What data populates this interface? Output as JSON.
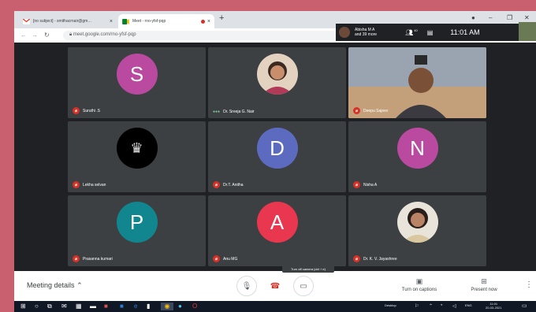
{
  "browser": {
    "tabs": [
      {
        "title": "[no subject] - smithacrnair@gm…",
        "active": false
      },
      {
        "title": "Meet - rno-yfsf-pqp",
        "active": true
      }
    ],
    "url": "meet.google.com/rno-yfsf-pqp"
  },
  "meet": {
    "participants_label": "Abisha M A",
    "participants_more": "and 39 more",
    "participant_count": "40",
    "time": "11:01 AM",
    "tiles": [
      {
        "name": "Suruthi .S",
        "initial": "S",
        "avatar_color": "#b94aa0",
        "muted": true
      },
      {
        "name": "Dr. Sreeja G. Nair",
        "initial": "",
        "avatar_color": "#e4d2c0",
        "muted": false
      },
      {
        "name": "Deepu Sajeev",
        "initial": "",
        "avatar_color": "#a57a5a",
        "muted": true
      },
      {
        "name": "Lekha selvan",
        "initial": "",
        "avatar_color": "#000000",
        "muted": true
      },
      {
        "name": "Dr.T. Anitha",
        "initial": "D",
        "avatar_color": "#5c6bc0",
        "muted": true
      },
      {
        "name": "Nisha A",
        "initial": "N",
        "avatar_color": "#b94aa0",
        "muted": true
      },
      {
        "name": "Prasanna kumari",
        "initial": "P",
        "avatar_color": "#11868f",
        "muted": true
      },
      {
        "name": "Anu MG",
        "initial": "A",
        "avatar_color": "#e8374f",
        "muted": true
      },
      {
        "name": "Dr. K. V. Jayashree",
        "initial": "",
        "avatar_color": "#e9e4da",
        "muted": true
      }
    ]
  },
  "controls": {
    "meeting_details": "Meeting details",
    "tooltip": "Turn off camera (ctrl + e)",
    "captions": "Turn on captions",
    "present": "Present now"
  },
  "taskbar": {
    "desktop": "Desktop",
    "lang": "ENG",
    "time": "11:01",
    "date": "20-03-2021"
  },
  "colors": {
    "accent_red": "#d93025",
    "meet_bg": "#202124",
    "tile_bg": "#3c4043"
  }
}
